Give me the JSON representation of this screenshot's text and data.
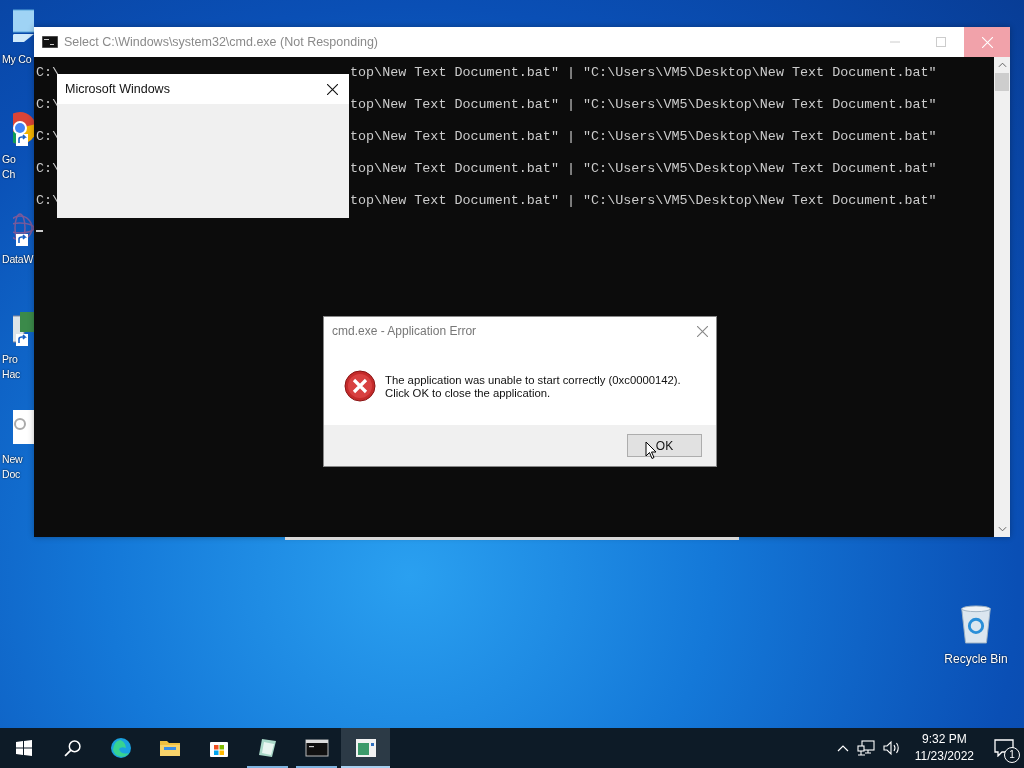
{
  "desktop_icons": [
    {
      "kind": "computer",
      "lines": [
        "My Co"
      ],
      "shortcut": false
    },
    {
      "kind": "browser",
      "lines": [
        "Go",
        "Ch"
      ],
      "shortcut": true
    },
    {
      "kind": "network",
      "lines": [
        "DataW"
      ],
      "shortcut": true
    },
    {
      "kind": "hardware",
      "lines": [
        "Pro",
        "Hac"
      ],
      "shortcut": true
    },
    {
      "kind": "document",
      "lines": [
        "New",
        "Doc"
      ],
      "shortcut": false
    }
  ],
  "recycle_bin": {
    "label": "Recycle Bin"
  },
  "console_window": {
    "title": "Select C:\\Windows\\system32\\cmd.exe (Not Responding)",
    "not_responding": true,
    "lines": [
      {
        "start": "C:\\",
        "rest": "top\\New Text Document.bat\" | \"C:\\Users\\VM5\\Desktop\\New Text Document.bat\""
      },
      {
        "start": "C:\\",
        "rest": "top\\New Text Document.bat\" | \"C:\\Users\\VM5\\Desktop\\New Text Document.bat\""
      },
      {
        "start": "C:\\",
        "rest": "top\\New Text Document.bat\" | \"C:\\Users\\VM5\\Desktop\\New Text Document.bat\""
      },
      {
        "start": "C:\\",
        "rest": "top\\New Text Document.bat\" | \"C:\\Users\\VM5\\Desktop\\New Text Document.bat\""
      },
      {
        "start": "C:\\",
        "rest": "top\\New Text Document.bat\" | \"C:\\Users\\VM5\\Desktop\\New Text Document.bat\""
      }
    ]
  },
  "message_window": {
    "title": "Microsoft Windows"
  },
  "error_dialog": {
    "title": "cmd.exe - Application Error",
    "message": [
      "The application was unable to start correctly (0xc0000142).",
      "Click OK to close the application."
    ],
    "button": "OK"
  },
  "taskbar": {
    "apps": [
      {
        "kind": "browser",
        "running": false,
        "selected": false
      },
      {
        "kind": "folder",
        "running": false,
        "selected": false
      },
      {
        "kind": "store",
        "running": false,
        "selected": false
      },
      {
        "kind": "notepad",
        "running": true,
        "selected": false
      },
      {
        "kind": "console",
        "running": true,
        "selected": false
      },
      {
        "kind": "app",
        "running": true,
        "selected": true
      }
    ],
    "clock": {
      "time": "9:32 PM",
      "date": "11/23/2022"
    },
    "notifications": {
      "count": "1"
    }
  }
}
